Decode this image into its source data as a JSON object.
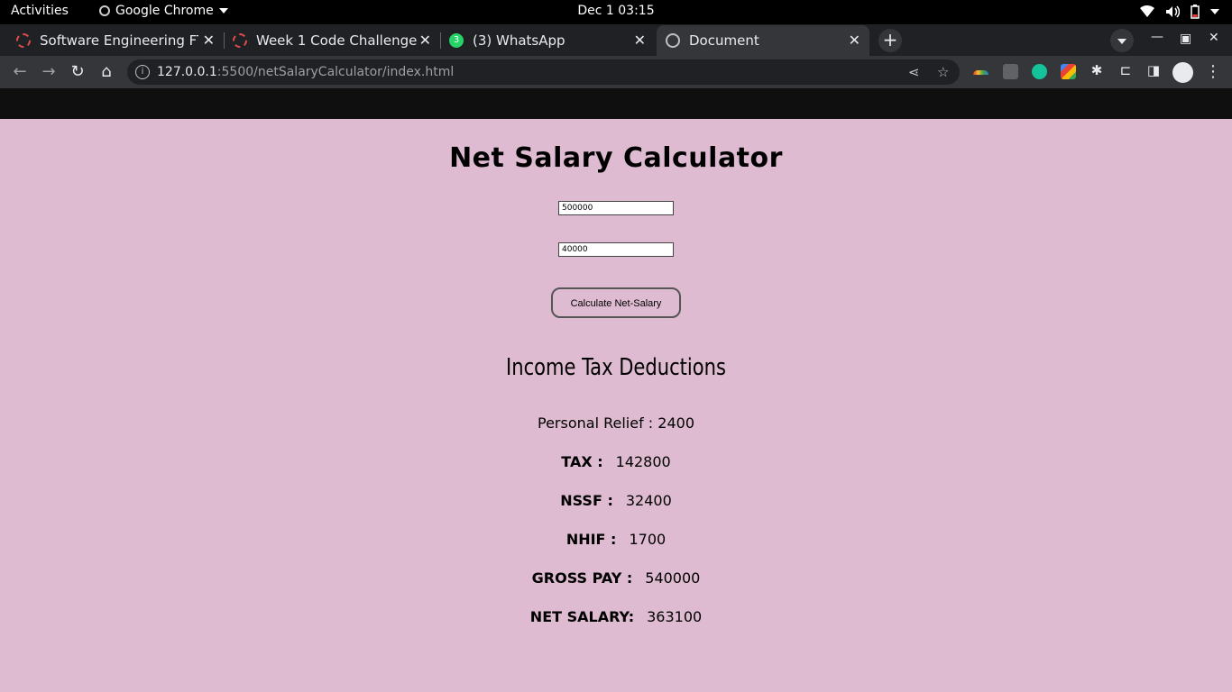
{
  "system": {
    "activities": "Activities",
    "app_name": "Google Chrome",
    "clock": "Dec 1  03:15",
    "tray_icons": [
      "wifi-icon",
      "volume-icon",
      "battery-icon",
      "power-menu-icon"
    ]
  },
  "tabs": [
    {
      "title": "Software Engineering FT C",
      "favicon": "red-dashed-circle-icon",
      "active": false
    },
    {
      "title": "Week 1 Code Challenge",
      "favicon": "red-dashed-circle-icon",
      "active": false
    },
    {
      "title": "(3) WhatsApp",
      "favicon": "whatsapp-icon",
      "badge": "3",
      "active": false
    },
    {
      "title": "Document",
      "favicon": "globe-icon",
      "active": true
    }
  ],
  "toolbar": {
    "url_host": "127.0.0.1",
    "url_rest": ":5500/netSalaryCalculator/index.html"
  },
  "page": {
    "title": "Net Salary Calculator",
    "basic_salary_value": "500000",
    "benefits_value": "40000",
    "calculate_button": "Calculate Net-Salary",
    "deductions_heading": "Income Tax Deductions",
    "personal_relief_label": "Personal Relief :",
    "personal_relief_value": "2400",
    "tax_label": "TAX :",
    "tax_value": "142800",
    "nssf_label": "NSSF :",
    "nssf_value": "32400",
    "nhif_label": "NHIF :",
    "nhif_value": "1700",
    "gross_pay_label": "GROSS PAY :",
    "gross_pay_value": "540000",
    "net_salary_label": "NET SALARY:",
    "net_salary_value": "363100"
  },
  "colors": {
    "page_background": "#debbd1",
    "tabstrip": "#202124",
    "toolbar": "#35363a"
  }
}
